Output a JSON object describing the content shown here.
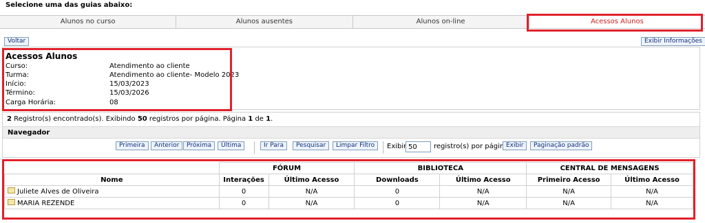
{
  "header": {
    "instruction": "Selecione uma das guias abaixo:"
  },
  "tabs": [
    {
      "label": "Alunos no curso",
      "active": false
    },
    {
      "label": "Alunos ausentes",
      "active": false
    },
    {
      "label": "Alunos on-line",
      "active": false
    },
    {
      "label": "Acessos Alunos",
      "active": true
    }
  ],
  "toolbar": {
    "back_label": "Voltar",
    "info_label": "Exibir Informações"
  },
  "course_info": {
    "title": "Acessos Alunos",
    "fields": [
      {
        "label": "Curso:",
        "value": "Atendimento ao cliente"
      },
      {
        "label": "Turma:",
        "value": "Atendimento ao cliente- Modelo 2023"
      },
      {
        "label": "Início:",
        "value": "15/03/2023"
      },
      {
        "label": "Término:",
        "value": "15/03/2026"
      },
      {
        "label": "Carga Horária:",
        "value": "08"
      }
    ]
  },
  "status": {
    "count": "2",
    "text1": " Registro(s) encontrado(s). Exibindo ",
    "per_page": "50",
    "text2": " registros por página. Página ",
    "page": "1",
    "text3": " de ",
    "total_pages": "1",
    "text4": "."
  },
  "navigator": {
    "title": "Navegador",
    "first": "Primeira",
    "previous": "Anterior",
    "next": "Próxima",
    "last": "Última",
    "goto": "Ir Para",
    "search": "Pesquisar",
    "clear_filter": "Limpar Filtro",
    "show_label": "Exibir",
    "show_value": "50",
    "per_page_label": "registro(s) por página.",
    "show_button": "Exibir",
    "default_pagination": "Paginação padrão"
  },
  "table": {
    "groups": [
      "FÓRUM",
      "BIBLIOTECA",
      "CENTRAL DE MENSAGENS"
    ],
    "columns": [
      "Nome",
      "Interações",
      "Último Acesso",
      "Downloads",
      "Último Acesso",
      "Primeiro Acesso",
      "Último Acesso"
    ],
    "rows": [
      [
        "Juliete Alves de Oliveira",
        "0",
        "N/A",
        "0",
        "N/A",
        "N/A",
        "N/A"
      ],
      [
        "MARIA REZENDE",
        "0",
        "N/A",
        "0",
        "N/A",
        "N/A",
        "N/A"
      ]
    ]
  },
  "colors": {
    "highlight": "#e0202a",
    "active_tab_text": "#cc2222",
    "button_text": "#10307a"
  }
}
